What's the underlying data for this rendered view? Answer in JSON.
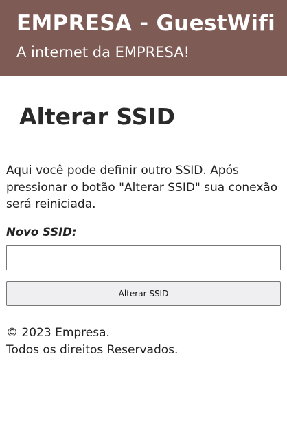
{
  "header": {
    "title": "EMPRESA - GuestWifi",
    "subtitle": "A internet da EMPRESA!",
    "background_color": "#7f5b55"
  },
  "main": {
    "page_title": "Alterar SSID",
    "description": "Aqui você pode definir outro SSID. Após pressionar o botão \"Alterar SSID\" sua conexão será reiniciada.",
    "field_label": "Novo SSID:",
    "ssid_value": "",
    "submit_label": "Alterar SSID"
  },
  "footer": {
    "copyright": "© 2023 Empresa.",
    "rights": "Todos os direitos Reservados."
  }
}
